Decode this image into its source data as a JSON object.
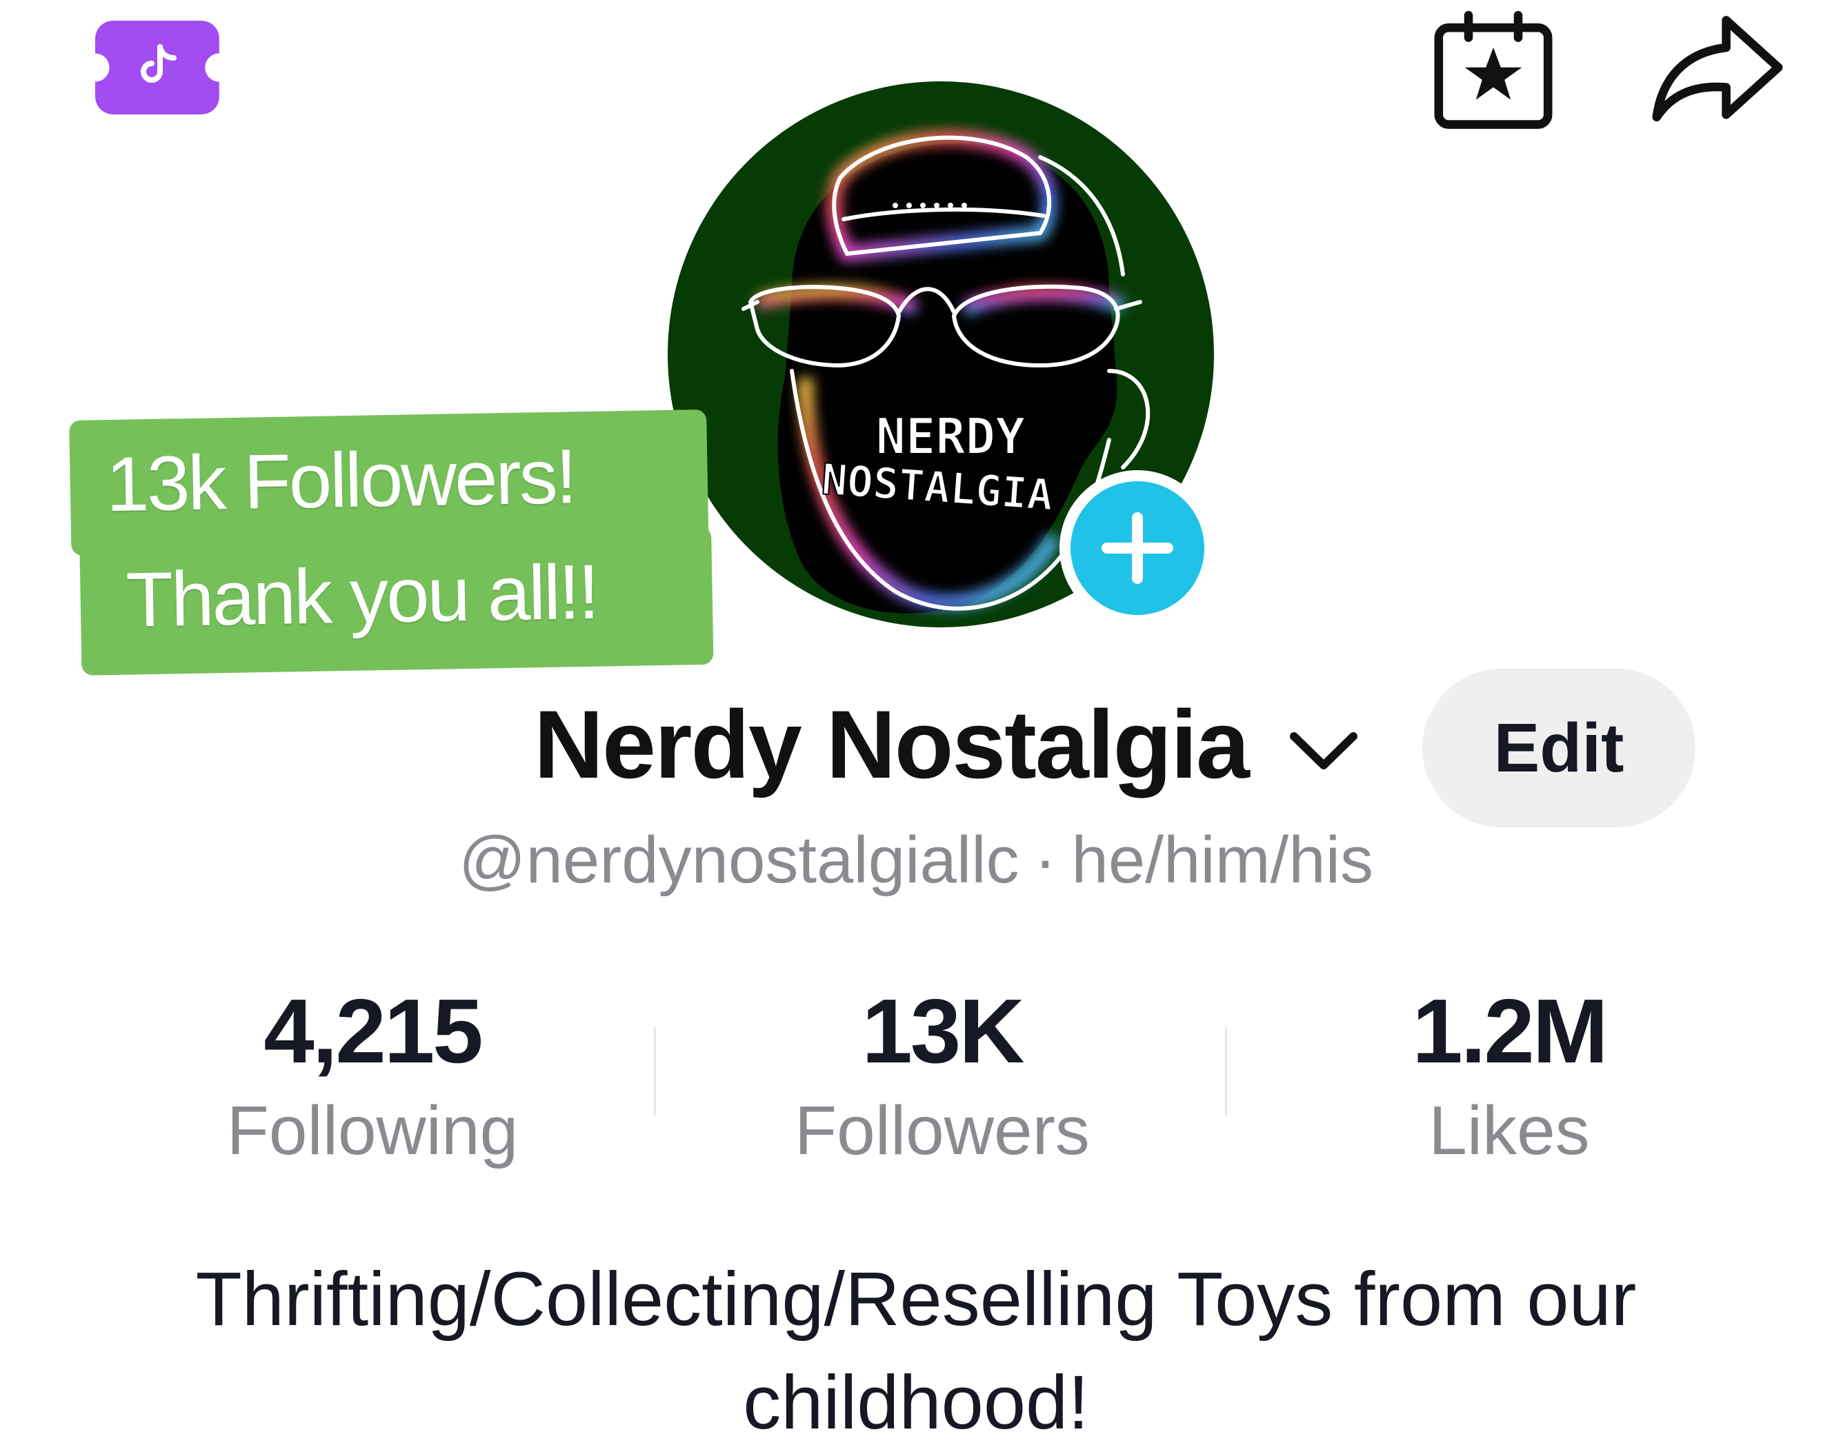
{
  "header": {
    "left_icon": "tiktok-ticket-icon",
    "right_icons": [
      "calendar-star-icon",
      "share-arrow-icon"
    ]
  },
  "avatar": {
    "text_line1": "NERDY",
    "text_line2": "NOSTALGIA",
    "add_icon": "plus-icon"
  },
  "caption": {
    "line1": "13k Followers!",
    "line2": "Thank you all!!"
  },
  "profile": {
    "display_name": "Nerdy Nostalgia",
    "handle": "@nerdynostalgiallc",
    "separator": "·",
    "pronouns": "he/him/his",
    "edit_label": "Edit",
    "bio": "Thrifting/Collecting/Reselling Toys from our childhood!"
  },
  "stats": [
    {
      "value": "4,215",
      "label": "Following"
    },
    {
      "value": "13K",
      "label": "Followers"
    },
    {
      "value": "1.2M",
      "label": "Likes"
    }
  ],
  "colors": {
    "ticket_purple": "#a24cf2",
    "follow_cyan": "#21c2e7",
    "caption_green": "#76c05a",
    "avatar_bg": "#063b06",
    "secondary_text": "#8a8b91"
  }
}
